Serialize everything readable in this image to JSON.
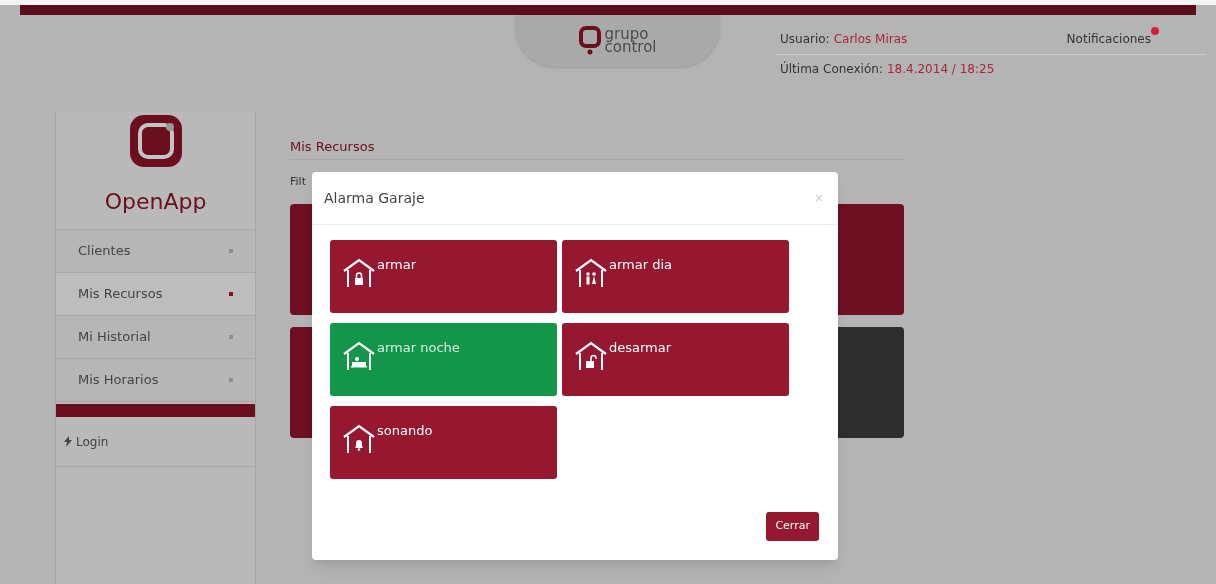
{
  "header": {
    "logo_lines": [
      "grupo",
      "control"
    ],
    "user_label": "Usuario:",
    "user_name": "Carlos Miras",
    "notifications": "Notificaciones",
    "last_connection_label": "Última Conexión:",
    "last_connection_value": "18.4.2014 / 18:25"
  },
  "sidebar": {
    "brand": "OpenApp",
    "items": [
      {
        "label": "Clientes",
        "selected": false
      },
      {
        "label": "Mis Recursos",
        "selected": true
      },
      {
        "label": "Mi Historial",
        "selected": false
      },
      {
        "label": "Mis Horarios",
        "selected": false
      }
    ],
    "login": "Login"
  },
  "main": {
    "title": "Mis Recursos",
    "filter_label": "Filt",
    "tiles": [
      {
        "color": "#6e1021"
      },
      {
        "color": "#6e1021"
      },
      {
        "color": "#6e1021"
      },
      {
        "color": "#2e2e2e"
      }
    ]
  },
  "modal": {
    "title": "Alarma Garaje",
    "close": "×",
    "actions": [
      {
        "label": "armar",
        "kind": "lock",
        "selected": false
      },
      {
        "label": "armar dia",
        "kind": "people",
        "selected": false
      },
      {
        "label": "armar noche",
        "kind": "bed",
        "selected": true
      },
      {
        "label": "desarmar",
        "kind": "unlock",
        "selected": false
      },
      {
        "label": "sonando",
        "kind": "bell",
        "selected": false
      }
    ],
    "button": "Cerrar"
  }
}
